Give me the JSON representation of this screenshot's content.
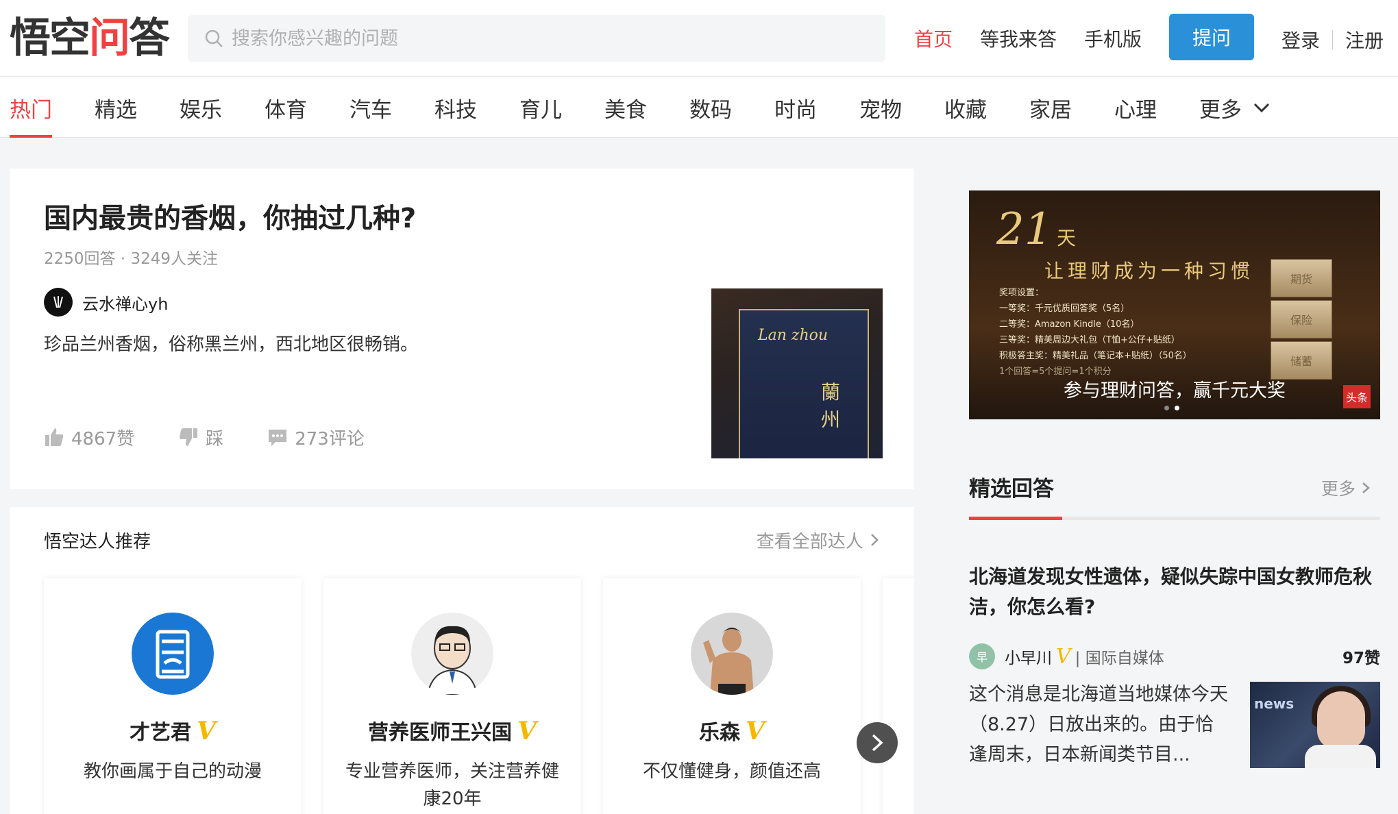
{
  "header": {
    "logo_part1": "悟空",
    "logo_part2": "问",
    "logo_part3": "答",
    "search_placeholder": "搜索你感兴趣的问题",
    "nav_home": "首页",
    "nav_answer": "等我来答",
    "nav_mobile": "手机版",
    "ask_button": "提问",
    "login": "登录",
    "register": "注册"
  },
  "categories": [
    "热门",
    "精选",
    "娱乐",
    "体育",
    "汽车",
    "科技",
    "育儿",
    "美食",
    "数码",
    "时尚",
    "宠物",
    "收藏",
    "家居",
    "心理",
    "更多"
  ],
  "feed": {
    "title": "国内最贵的香烟，你抽过几种?",
    "meta": "2250回答 · 3249人关注",
    "author": "云水禅心yh",
    "excerpt": "珍品兰州香烟，俗称黑兰州，西北地区很畅销。",
    "pack_brand_en": "Lan zhou",
    "pack_brand_cn": "蘭州",
    "likes": "4867赞",
    "dislike": "踩",
    "comments": "273评论"
  },
  "recommend": {
    "title": "悟空达人推荐",
    "more": "查看全部达人",
    "talents": [
      {
        "name": "才艺君",
        "v": "V",
        "desc": "教你画属于自己的动漫"
      },
      {
        "name": "营养医师王兴国",
        "v": "V",
        "desc": "专业营养医师，关注营养健康20年"
      },
      {
        "name": "乐森",
        "v": "V",
        "desc": "不仅懂健身，颜值还高"
      }
    ]
  },
  "banner": {
    "number": "21",
    "day": "天",
    "slogan": "让理财成为一种习惯",
    "list": [
      "奖项设置：",
      "一等奖：千元优质回答奖（5名）",
      "二等奖：Amazon Kindle（10名）",
      "三等奖：精美周边大礼包（T恤+公仔+贴纸）",
      "积极答主奖：精美礼品（笔记本+贴纸）（50名）",
      "1个回答=5个提问=1个积分"
    ],
    "blocks": [
      "期货",
      "保险",
      "储蓄"
    ],
    "caption": "参与理财问答，赢千元大奖",
    "badge": "头条"
  },
  "featured": {
    "title": "精选回答",
    "more": "更多",
    "question": "北海道发现女性遗体，疑似失踪中国女教师危秋洁，你怎么看?",
    "user": "小早川",
    "user_v": "V",
    "org": "| 国际自媒体",
    "likes": "97赞",
    "text": "这个消息是北海道当地媒体今天（8.27）日放出来的。由于恰逢周末，日本新闻类节目...",
    "thumb_text": "news"
  },
  "colors": {
    "accent_red": "#f04142",
    "button_blue": "#2a90d7",
    "verified_gold": "#f5b800"
  }
}
